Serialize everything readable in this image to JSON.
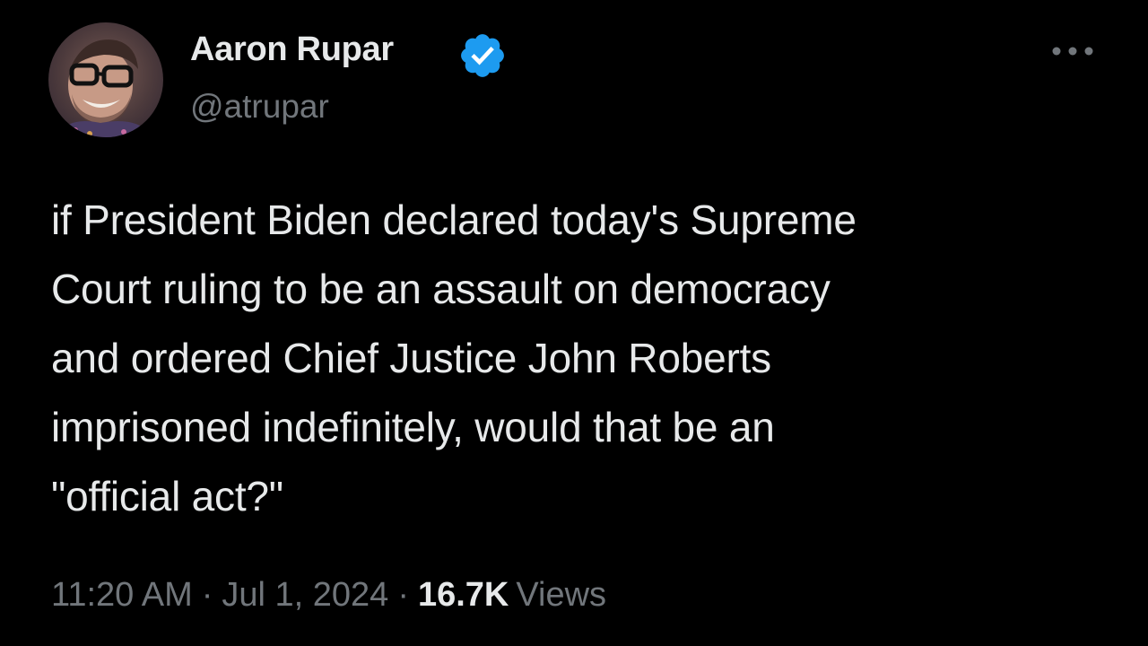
{
  "tweet": {
    "author": {
      "name": "Aaron Rupar",
      "handle": "@atrupar",
      "verified": true
    },
    "text": "if President Biden declared today's Supreme\nCourt ruling to be an assault on democracy\nand ordered Chief Justice John Roberts\nimprisoned indefinitely, would that be an\n\"official act?\"",
    "time": "11:20 AM",
    "date": "Jul 1, 2024",
    "views_count": "16.7K",
    "views_label": "Views",
    "separator": "·"
  },
  "colors": {
    "background": "#000000",
    "primary_text": "#e7e9ea",
    "secondary_text": "#71767b",
    "verified_blue": "#1d9bf0"
  },
  "icons": {
    "verified": "verified-badge-icon",
    "more": "more-horizontal-icon"
  }
}
